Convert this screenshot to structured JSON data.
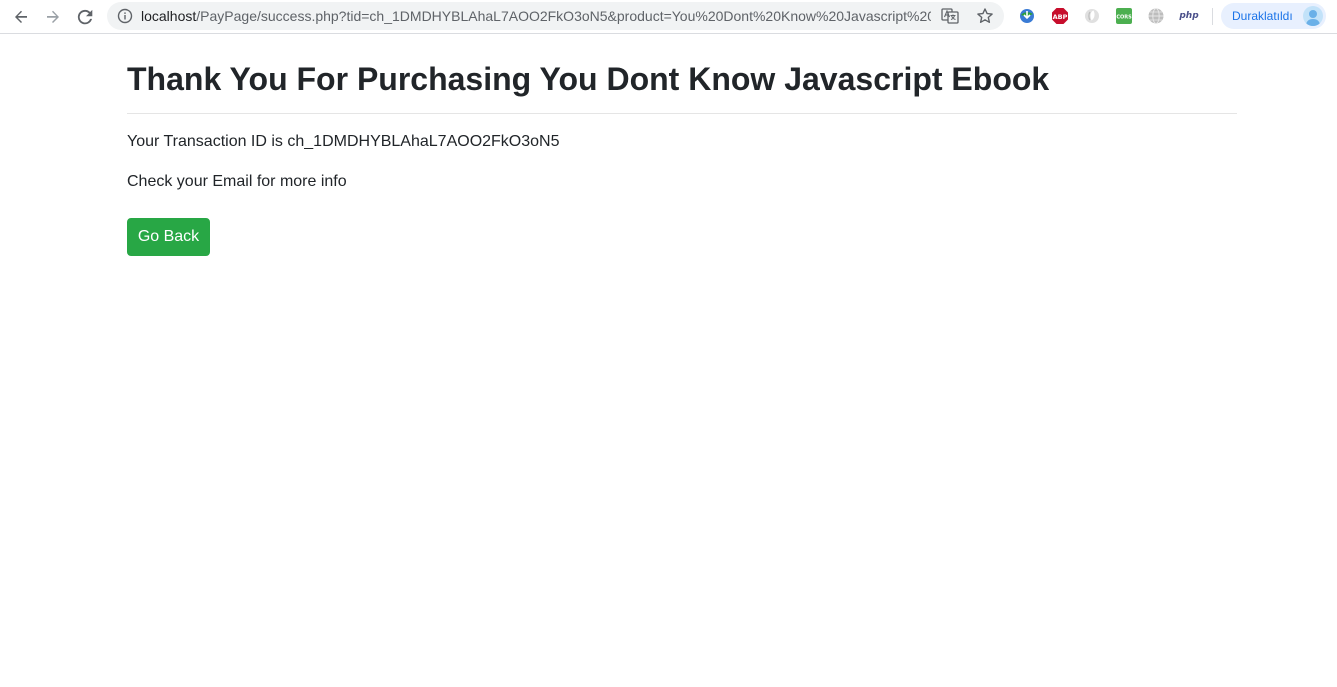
{
  "browser": {
    "url_host": "localhost",
    "url_rest": "/PayPage/success.php?tid=ch_1DMDHYBLAhaL7AOO2FkO3oN5&product=You%20Dont%20Know%20Javascript%20...",
    "extensions": [
      "idm-icon",
      "adblock-plus-icon",
      "grey-extension-icon",
      "cors-icon",
      "globe-icon",
      "php-icon"
    ],
    "php_ext_label": "php",
    "profile_status": "Duraklatıldı",
    "accent_color": "#1a73e8"
  },
  "page": {
    "title": "Thank You For Purchasing You Dont Know Javascript Ebook",
    "transaction_line": "Your Transaction ID is ch_1DMDHYBLAhaL7AOO2FkO3oN5",
    "email_line": "Check your Email for more info",
    "go_back_label": "Go Back",
    "button_color": "#28a745"
  }
}
